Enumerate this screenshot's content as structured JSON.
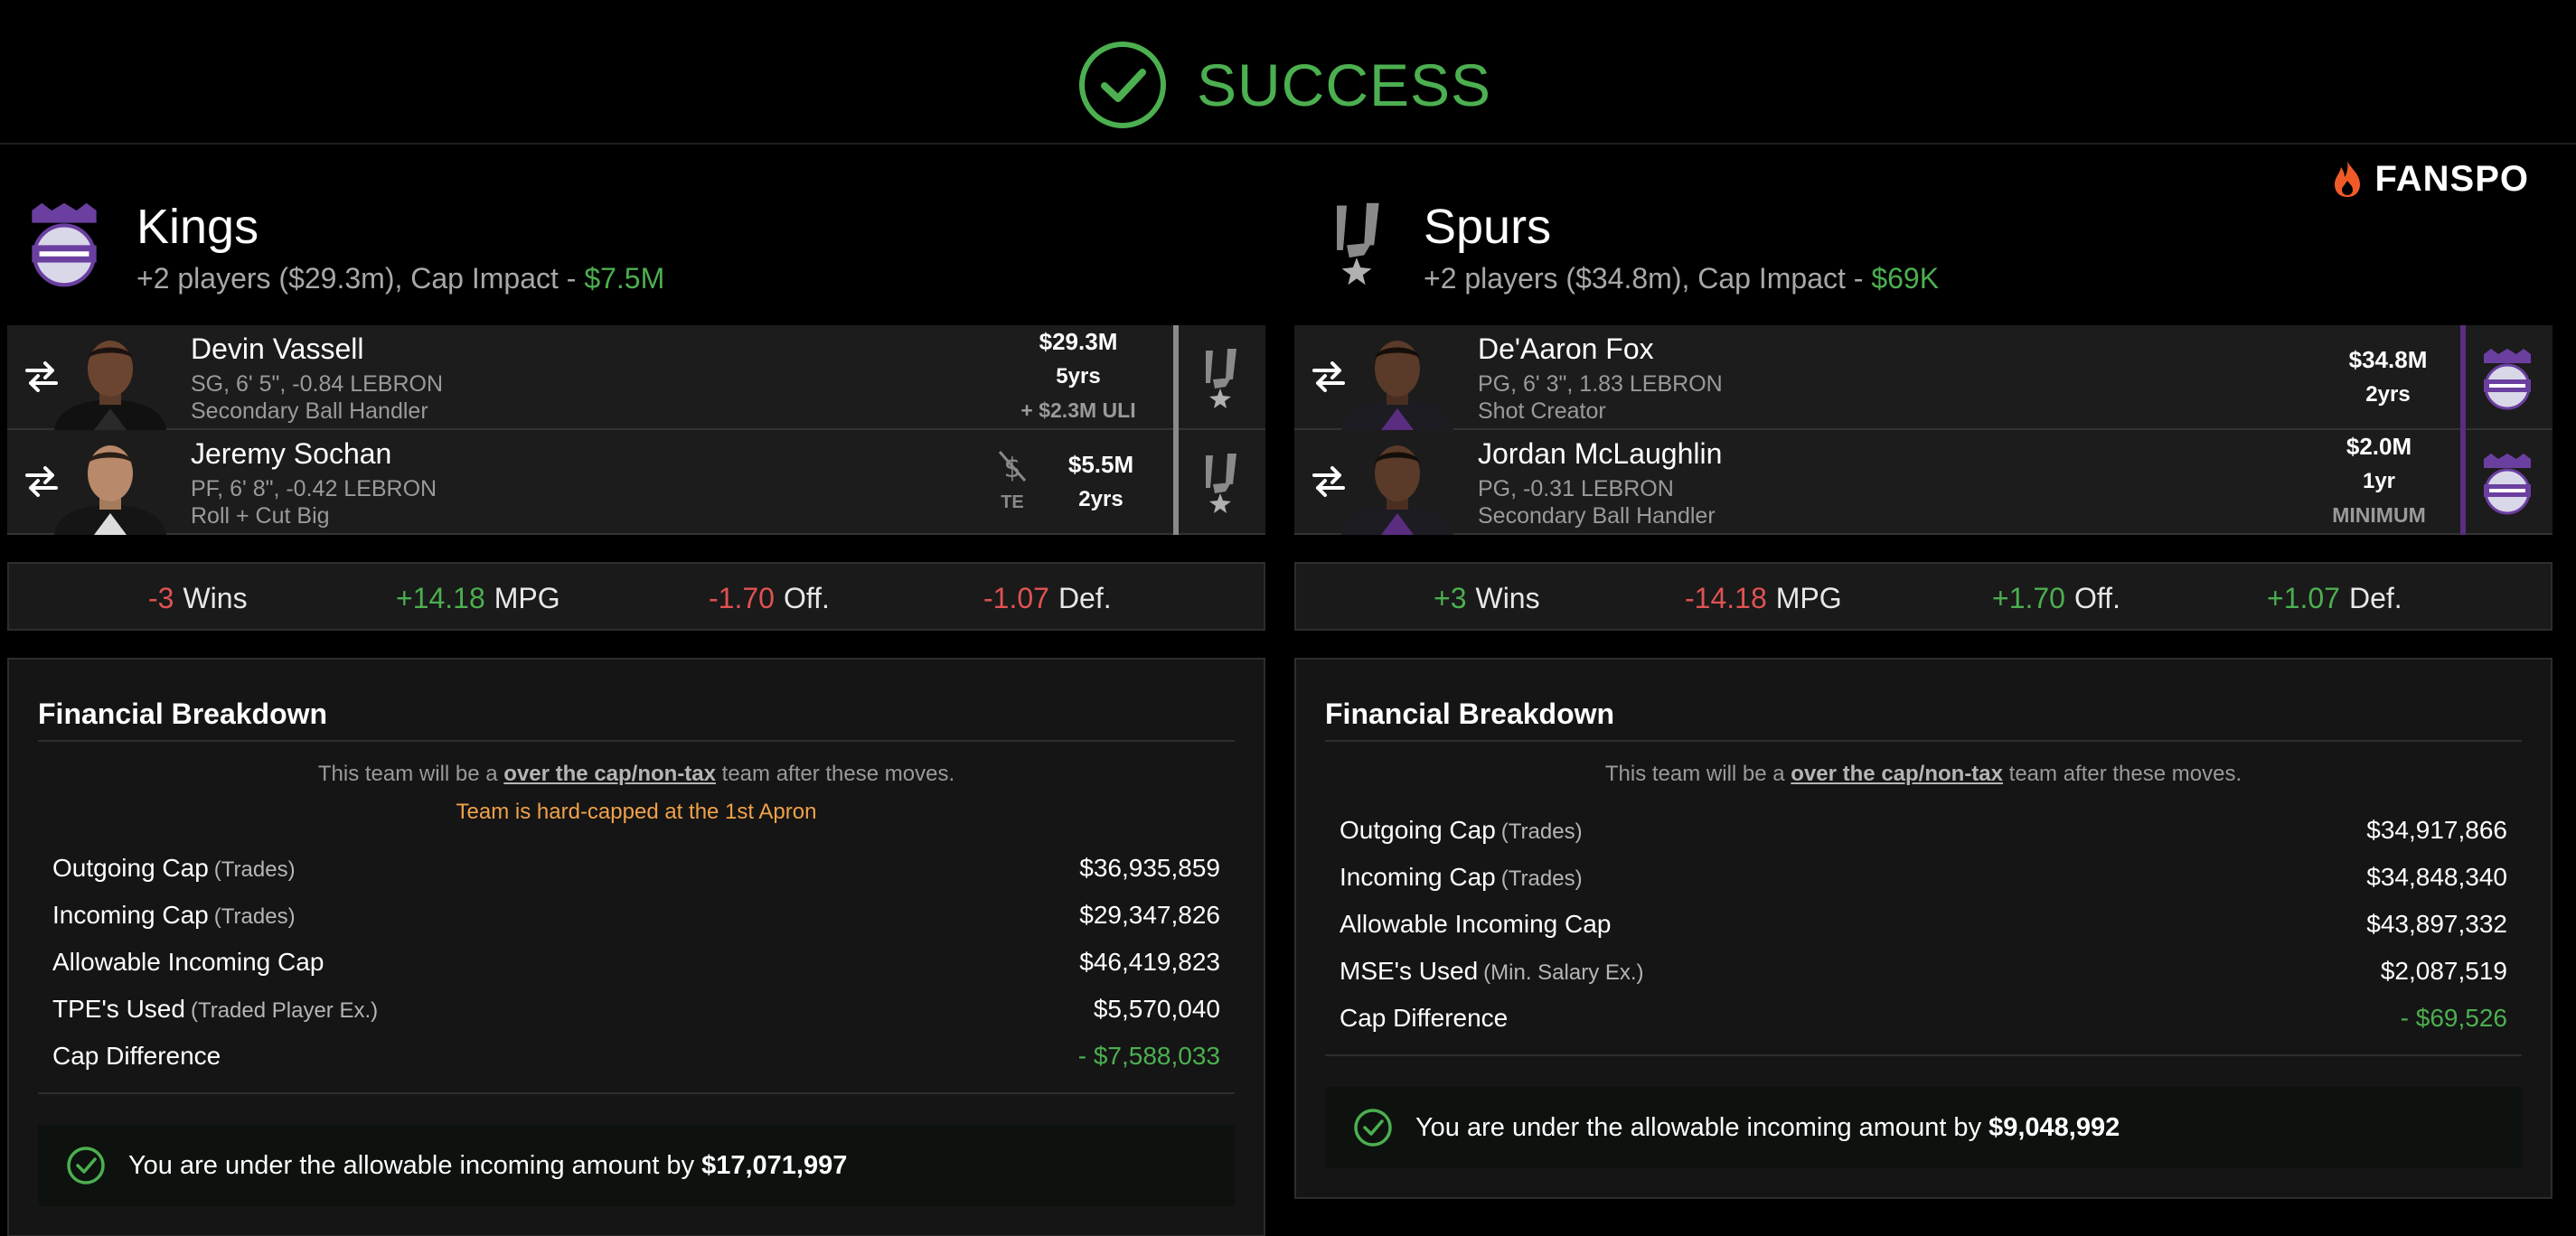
{
  "header": {
    "status": "SUCCESS",
    "brand": "FANSPO"
  },
  "colors": {
    "success": "#4caf50",
    "negative": "#e05252",
    "warning": "#f0a24a",
    "kings_purple": "#5a2d81",
    "spurs_gray": "#8a8a8a"
  },
  "left": {
    "team": "Kings",
    "summary": "+2 players ($29.3m), Cap Impact - ",
    "impact": "$7.5M",
    "players": [
      {
        "name": "Devin Vassell",
        "info1": "SG, 6' 5\", -0.84 LEBRON",
        "info2": "Secondary Ball Handler",
        "salary": "$29.3M",
        "years": "5yrs",
        "note": "+ $2.3M ULI",
        "dest_icon": "spurs-logo-icon"
      },
      {
        "name": "Jeremy Sochan",
        "info1": "PF, 6' 8\", -0.42 LEBRON",
        "info2": "Roll + Cut Big",
        "salary": "$5.5M",
        "years": "2yrs",
        "te_label": "TE",
        "dest_icon": "spurs-logo-icon"
      }
    ],
    "stats": [
      {
        "value": "-3",
        "label": "Wins",
        "sign": "neg"
      },
      {
        "value": "+14.18",
        "label": "MPG",
        "sign": "pos"
      },
      {
        "value": "-1.70",
        "label": "Off.",
        "sign": "neg"
      },
      {
        "value": "-1.07",
        "label": "Def.",
        "sign": "neg"
      }
    ],
    "financial": {
      "title": "Financial Breakdown",
      "note_pre": "This team will be a ",
      "note_link": "over the cap/non-tax",
      "note_post": " team after these moves.",
      "hard_cap": "Team is hard-capped at the 1st Apron",
      "rows": [
        {
          "label": "Outgoing Cap",
          "sub": "(Trades)",
          "value": "$36,935,859"
        },
        {
          "label": "Incoming Cap",
          "sub": "(Trades)",
          "value": "$29,347,826"
        },
        {
          "label": "Allowable Incoming Cap",
          "sub": "",
          "value": "$46,419,823"
        },
        {
          "label": "TPE's Used",
          "sub": "(Traded Player Ex.)",
          "value": "$5,570,040"
        },
        {
          "label": "Cap Difference",
          "sub": "",
          "value": "- $7,588,033"
        }
      ],
      "under_text": "You are under the allowable incoming amount by",
      "under_amount": "$17,071,997"
    }
  },
  "right": {
    "team": "Spurs",
    "summary": "+2 players ($34.8m), Cap Impact - ",
    "impact": "$69K",
    "players": [
      {
        "name": "De'Aaron Fox",
        "info1": "PG, 6' 3\", 1.83 LEBRON",
        "info2": "Shot Creator",
        "salary": "$34.8M",
        "years": "2yrs",
        "dest_icon": "kings-logo-icon"
      },
      {
        "name": "Jordan McLaughlin",
        "info1": "PG, -0.31 LEBRON",
        "info2": "Secondary Ball Handler",
        "salary": "$2.0M",
        "years": "1yr",
        "note": "MINIMUM",
        "dest_icon": "kings-logo-icon"
      }
    ],
    "stats": [
      {
        "value": "+3",
        "label": "Wins",
        "sign": "pos"
      },
      {
        "value": "-14.18",
        "label": "MPG",
        "sign": "neg"
      },
      {
        "value": "+1.70",
        "label": "Off.",
        "sign": "pos"
      },
      {
        "value": "+1.07",
        "label": "Def.",
        "sign": "pos"
      }
    ],
    "financial": {
      "title": "Financial Breakdown",
      "note_pre": "This team will be a ",
      "note_link": "over the cap/non-tax",
      "note_post": " team after these moves.",
      "rows": [
        {
          "label": "Outgoing Cap",
          "sub": "(Trades)",
          "value": "$34,917,866"
        },
        {
          "label": "Incoming Cap",
          "sub": "(Trades)",
          "value": "$34,848,340"
        },
        {
          "label": "Allowable Incoming Cap",
          "sub": "",
          "value": "$43,897,332"
        },
        {
          "label": "MSE's Used",
          "sub": "(Min. Salary Ex.)",
          "value": "$2,087,519"
        },
        {
          "label": "Cap Difference",
          "sub": "",
          "value": "- $69,526"
        }
      ],
      "under_text": "You are under the allowable incoming amount by",
      "under_amount": "$9,048,992"
    }
  }
}
